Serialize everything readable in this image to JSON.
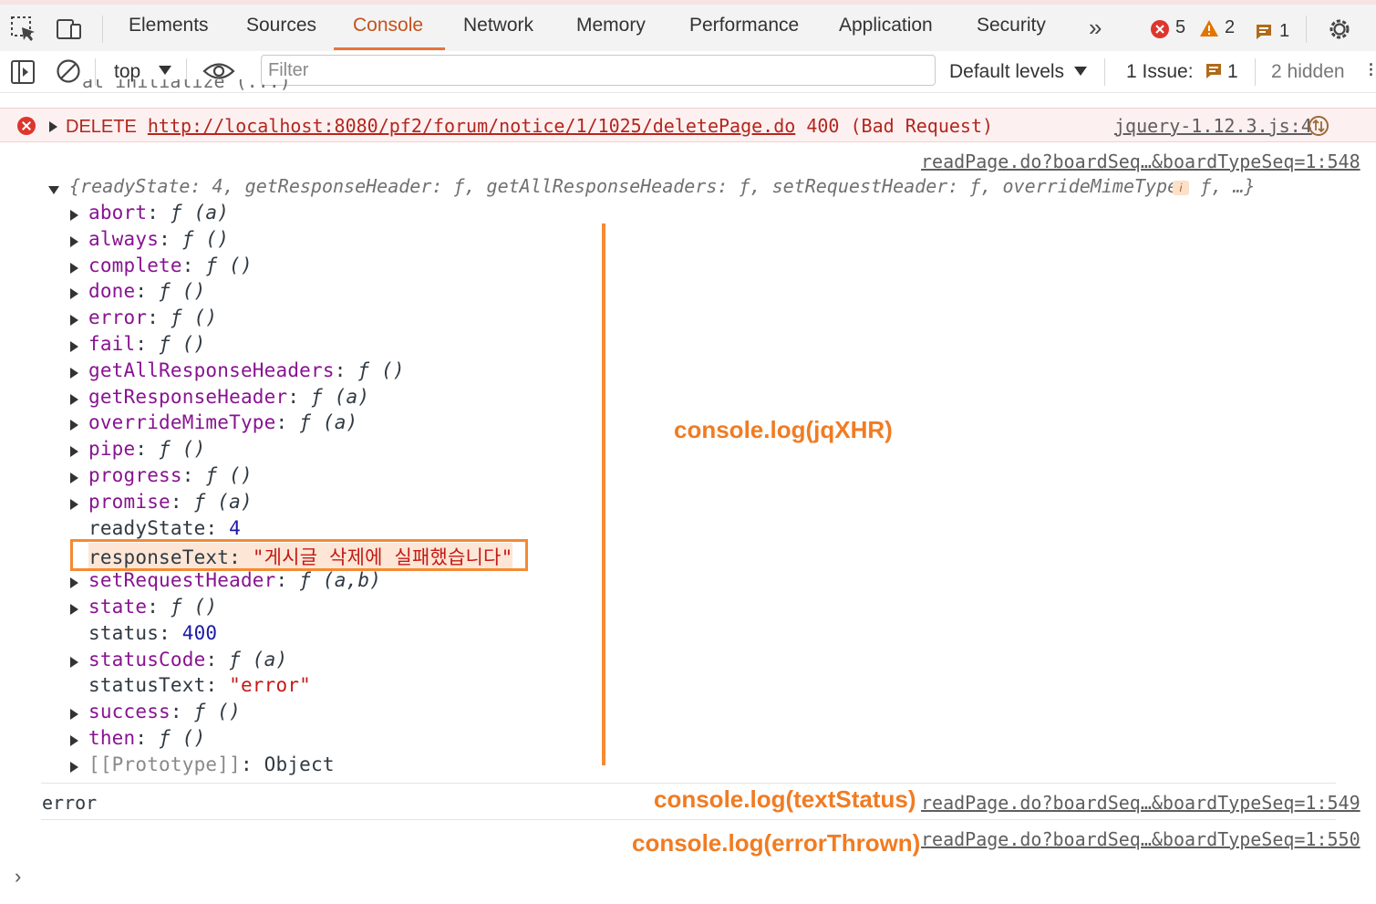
{
  "tabs": [
    "Elements",
    "Sources",
    "Console",
    "Network",
    "Memory",
    "Performance",
    "Application",
    "Security"
  ],
  "active_tab": "Console",
  "counts": {
    "errors": "5",
    "warnings": "2",
    "info": "1"
  },
  "filterbar": {
    "context": "top",
    "filter_placeholder": "Filter",
    "levels": "Default levels",
    "issues_label": "1 Issue:",
    "issues_count": "1",
    "hidden": "2 hidden"
  },
  "console": {
    "truncated_line": "at initialize (...)",
    "error": {
      "method": "DELETE",
      "url": "http://localhost:8080/pf2/forum/notice/1/1025/deletePage.do",
      "status": "400 (Bad Request)",
      "source": "jquery-1.12.3.js:4"
    },
    "log1_source": "readPage.do?boardSeq…&boardTypeSeq=1:548",
    "object_summary": "{readyState: 4, getResponseHeader: ƒ, getAllResponseHeaders: ƒ, setRequestHeader: ƒ, overrideMimeType: ƒ, …}",
    "properties": [
      {
        "key": "abort",
        "value": "ƒ (a)",
        "kind": "func"
      },
      {
        "key": "always",
        "value": "ƒ ()",
        "kind": "func"
      },
      {
        "key": "complete",
        "value": "ƒ ()",
        "kind": "func"
      },
      {
        "key": "done",
        "value": "ƒ ()",
        "kind": "func"
      },
      {
        "key": "error",
        "value": "ƒ ()",
        "kind": "func"
      },
      {
        "key": "fail",
        "value": "ƒ ()",
        "kind": "func"
      },
      {
        "key": "getAllResponseHeaders",
        "value": "ƒ ()",
        "kind": "func"
      },
      {
        "key": "getResponseHeader",
        "value": "ƒ (a)",
        "kind": "func"
      },
      {
        "key": "overrideMimeType",
        "value": "ƒ (a)",
        "kind": "func"
      },
      {
        "key": "pipe",
        "value": "ƒ ()",
        "kind": "func"
      },
      {
        "key": "progress",
        "value": "ƒ ()",
        "kind": "func"
      },
      {
        "key": "promise",
        "value": "ƒ (a)",
        "kind": "func"
      },
      {
        "key": "readyState",
        "value": "4",
        "kind": "num"
      },
      {
        "key": "responseText",
        "value": "\"게시글 삭제에 실패했습니다\"",
        "kind": "str"
      },
      {
        "key": "setRequestHeader",
        "value": "ƒ (a,b)",
        "kind": "func"
      },
      {
        "key": "state",
        "value": "ƒ ()",
        "kind": "func"
      },
      {
        "key": "status",
        "value": "400",
        "kind": "num"
      },
      {
        "key": "statusCode",
        "value": "ƒ (a)",
        "kind": "func"
      },
      {
        "key": "statusText",
        "value": "\"error\"",
        "kind": "str"
      },
      {
        "key": "success",
        "value": "ƒ ()",
        "kind": "func"
      },
      {
        "key": "then",
        "value": "ƒ ()",
        "kind": "func"
      },
      {
        "key": "[[Prototype]]",
        "value": "Object",
        "kind": "proto"
      }
    ],
    "log2_text": "error",
    "log2_source": "readPage.do?boardSeq…&boardTypeSeq=1:549",
    "log3_source": "readPage.do?boardSeq…&boardTypeSeq=1:550"
  },
  "annotations": {
    "jqxhr": "console.log(jqXHR)",
    "textstatus": "console.log(textStatus)",
    "errorthrown": "console.log(errorThrown)"
  }
}
